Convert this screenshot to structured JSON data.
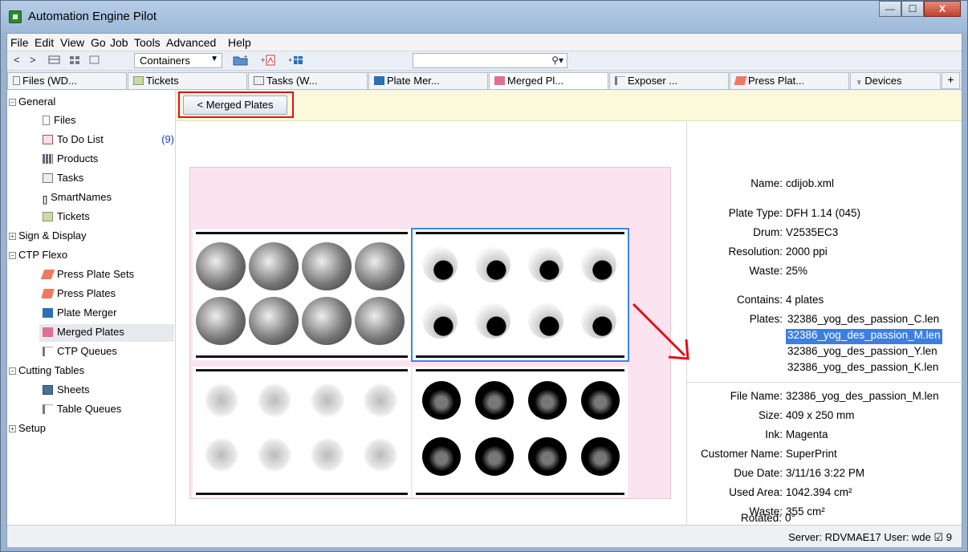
{
  "window": {
    "title": "Automation Engine Pilot",
    "minimize": "—",
    "maximize": "☐",
    "close": "X"
  },
  "menu": [
    "File",
    "Edit",
    "View",
    "Go",
    "Job",
    "Tools",
    "Advanced",
    "Help"
  ],
  "toolbar": {
    "nav_back": "<",
    "nav_forward": ">",
    "view_selector": "Containers",
    "search_value": "",
    "search_icon": "search-icon"
  },
  "tabs": [
    {
      "label": "Files (WD...",
      "icon": "file-icon"
    },
    {
      "label": "Tickets",
      "icon": "ticket-icon"
    },
    {
      "label": "Tasks (W...",
      "icon": "tasks-icon"
    },
    {
      "label": "Plate Mer...",
      "icon": "plate-merger-icon"
    },
    {
      "label": "Merged Pl...",
      "icon": "merged-plates-icon"
    },
    {
      "label": "Exposer ...",
      "icon": "exposer-icon"
    },
    {
      "label": "Press Plat...",
      "icon": "press-plate-icon"
    },
    {
      "label": "Devices",
      "icon": "devices-icon"
    },
    {
      "label": "+"
    }
  ],
  "tree": {
    "general": "General",
    "files": "Files",
    "todo": "To Do List",
    "todo_count": "(9)",
    "products": "Products",
    "tasks": "Tasks",
    "smartnames": "SmartNames",
    "tickets": "Tickets",
    "sign_display": "Sign & Display",
    "ctp_flexo": "CTP Flexo",
    "press_plate_sets": "Press Plate Sets",
    "press_plates": "Press Plates",
    "plate_merger": "Plate Merger",
    "merged_plates": "Merged Plates",
    "ctp_queues": "CTP Queues",
    "cutting_tables": "Cutting Tables",
    "sheets": "Sheets",
    "table_queues": "Table Queues",
    "setup": "Setup"
  },
  "header": {
    "back_button": "< Merged Plates"
  },
  "details": {
    "name_label": "Name:",
    "name": "cdijob.xml",
    "plate_type_label": "Plate Type:",
    "plate_type": "DFH 1.14 (045)",
    "drum_label": "Drum:",
    "drum": "V2535EC3",
    "resolution_label": "Resolution:",
    "resolution": "2000 ppi",
    "waste_label": "Waste:",
    "waste": "25%",
    "contains_label": "Contains:",
    "contains": "4 plates",
    "plates_label": "Plates:",
    "plates": [
      "32386_yog_des_passion_C.len",
      "32386_yog_des_passion_M.len",
      "32386_yog_des_passion_Y.len",
      "32386_yog_des_passion_K.len"
    ],
    "file_name_label": "File Name:",
    "file_name": "32386_yog_des_passion_M.len",
    "size_label": "Size:",
    "size": "409 x 250 mm",
    "ink_label": "Ink:",
    "ink": "Magenta",
    "customer_label": "Customer Name:",
    "customer": "SuperPrint",
    "due_label": "Due Date:",
    "due": "3/11/16 3:22 PM",
    "used_area_label": "Used Area:",
    "used_area": "1042.394 cm²",
    "waste2_label": "Waste:",
    "waste2": "355 cm²",
    "rotated_label": "Rotated:",
    "rotated": "0°"
  },
  "status": {
    "text": "Server: RDVMAE17   User: wde   ☑ 9"
  },
  "colors": {
    "accent": "#3d7fe0",
    "highlight_frame": "#e0121a",
    "sheet": "#fbe4ef"
  }
}
